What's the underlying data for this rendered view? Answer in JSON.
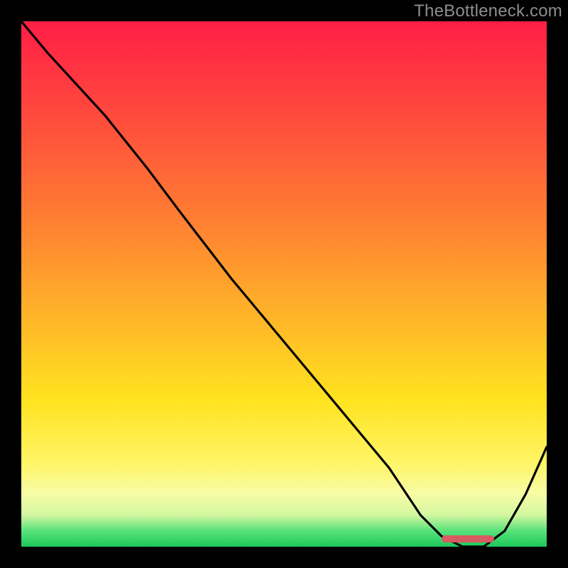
{
  "watermark": "TheBottleneck.com",
  "colors": {
    "gradient_top": "#ff1e46",
    "gradient_bottom": "#1cc85b",
    "curve": "#000000",
    "bar": "#d85a62",
    "frame_bg": "#000000",
    "watermark": "#8e8e8e"
  },
  "chart_data": {
    "type": "line",
    "title": "",
    "xlabel": "",
    "ylabel": "",
    "xlim": [
      0,
      100
    ],
    "ylim": [
      0,
      100
    ],
    "x": [
      0,
      5,
      16,
      20,
      24,
      30,
      40,
      50,
      60,
      70,
      76,
      80,
      84,
      88,
      92,
      96,
      100
    ],
    "values": [
      100,
      94,
      82,
      77,
      72,
      64,
      51,
      39,
      27,
      15,
      6,
      2,
      0,
      0,
      3,
      10,
      19
    ],
    "annotations": {
      "optimal_range_x": [
        80,
        90
      ],
      "optimal_band_color": "#d85a62"
    }
  }
}
